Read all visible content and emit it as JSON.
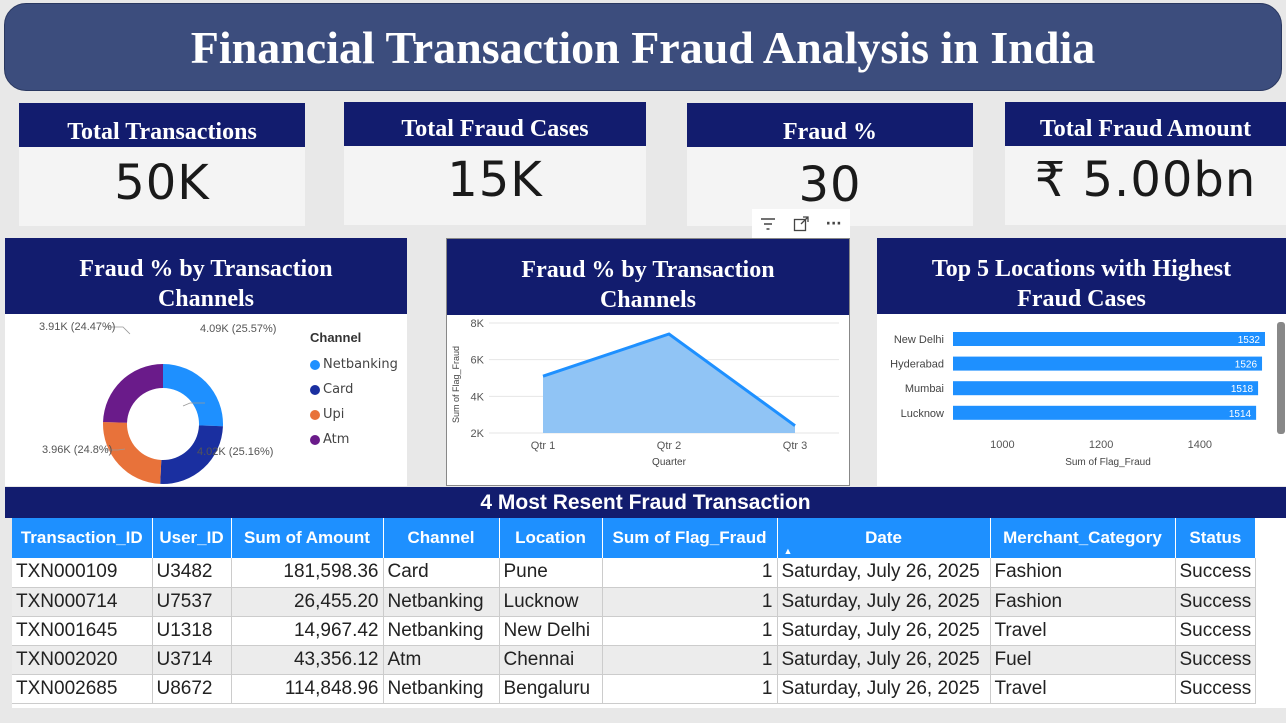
{
  "title": "Financial Transaction Fraud Analysis in India",
  "kpis": [
    {
      "label": "Total Transactions",
      "value": "50K"
    },
    {
      "label": "Total Fraud Cases",
      "value": "15K"
    },
    {
      "label": "Fraud %",
      "value": "30"
    },
    {
      "label": "Total Fraud Amount",
      "value": "₹ 5.00bn"
    }
  ],
  "toolbar": {
    "filter_icon": "filter-icon",
    "focus_icon": "focus-mode-icon",
    "more_icon": "more-options-icon",
    "more_label": "···"
  },
  "donut": {
    "title": "Fraud % by Transaction Channels",
    "legend_title": "Channel",
    "labels": {
      "netbanking": "4.09K (25.57%)",
      "card": "4.02K (25.16%)",
      "upi": "3.96K (24.8%)",
      "atm": "3.91K (24.47%)"
    },
    "legend": [
      "Netbanking",
      "Card",
      "Upi",
      "Atm"
    ],
    "colors": {
      "netbanking": "#1e90ff",
      "card": "#1a2fa0",
      "upi": "#e8723a",
      "atm": "#6a1b8a"
    }
  },
  "area": {
    "title": "Fraud % by Transaction Channels",
    "ylabel": "Sum of Flag_Fraud",
    "xlabel": "Quarter",
    "yticks": [
      "8K",
      "6K",
      "4K",
      "2K"
    ],
    "xticks": [
      "Qtr 1",
      "Qtr 2",
      "Qtr 3"
    ]
  },
  "bars": {
    "title": "Top 5 Locations with Highest Fraud Cases",
    "xlabel": "Sum of Flag_Fraud",
    "xticks": [
      "1000",
      "1200",
      "1400"
    ],
    "color": "#1e90ff"
  },
  "chart_data": [
    {
      "type": "pie",
      "title": "Fraud % by Transaction Channels",
      "categories": [
        "Netbanking",
        "Card",
        "Upi",
        "Atm"
      ],
      "values": [
        4090,
        4020,
        3960,
        3910
      ],
      "percent": [
        25.57,
        25.16,
        24.8,
        24.47
      ]
    },
    {
      "type": "area",
      "title": "Fraud % by Transaction Channels",
      "categories": [
        "Qtr 1",
        "Qtr 2",
        "Qtr 3"
      ],
      "values": [
        5100,
        7400,
        2400
      ],
      "xlabel": "Quarter",
      "ylabel": "Sum of Flag_Fraud",
      "ylim": [
        2000,
        8000
      ]
    },
    {
      "type": "bar",
      "title": "Top 5 Locations with Highest Fraud Cases",
      "categories": [
        "New Delhi",
        "Hyderabad",
        "Mumbai",
        "Lucknow"
      ],
      "values": [
        1532,
        1526,
        1518,
        1514
      ],
      "xlabel": "Sum of Flag_Fraud",
      "xlim": [
        900,
        1532
      ]
    }
  ],
  "table": {
    "title": "4 Most Resent Fraud Transaction",
    "columns": [
      "Transaction_ID",
      "User_ID",
      "Sum of Amount",
      "Channel",
      "Location",
      "Sum of Flag_Fraud",
      "Date",
      "Merchant_Category",
      "Status"
    ],
    "rows": [
      [
        "TXN000109",
        "U3482",
        "181,598.36",
        "Card",
        "Pune",
        "1",
        "Saturday, July 26, 2025",
        "Fashion",
        "Success"
      ],
      [
        "TXN000714",
        "U7537",
        "26,455.20",
        "Netbanking",
        "Lucknow",
        "1",
        "Saturday, July 26, 2025",
        "Fashion",
        "Success"
      ],
      [
        "TXN001645",
        "U1318",
        "14,967.42",
        "Netbanking",
        "New Delhi",
        "1",
        "Saturday, July 26, 2025",
        "Travel",
        "Success"
      ],
      [
        "TXN002020",
        "U3714",
        "43,356.12",
        "Atm",
        "Chennai",
        "1",
        "Saturday, July 26, 2025",
        "Fuel",
        "Success"
      ],
      [
        "TXN002685",
        "U8672",
        "114,848.96",
        "Netbanking",
        "Bengaluru",
        "1",
        "Saturday, July 26, 2025",
        "Travel",
        "Success"
      ]
    ]
  }
}
